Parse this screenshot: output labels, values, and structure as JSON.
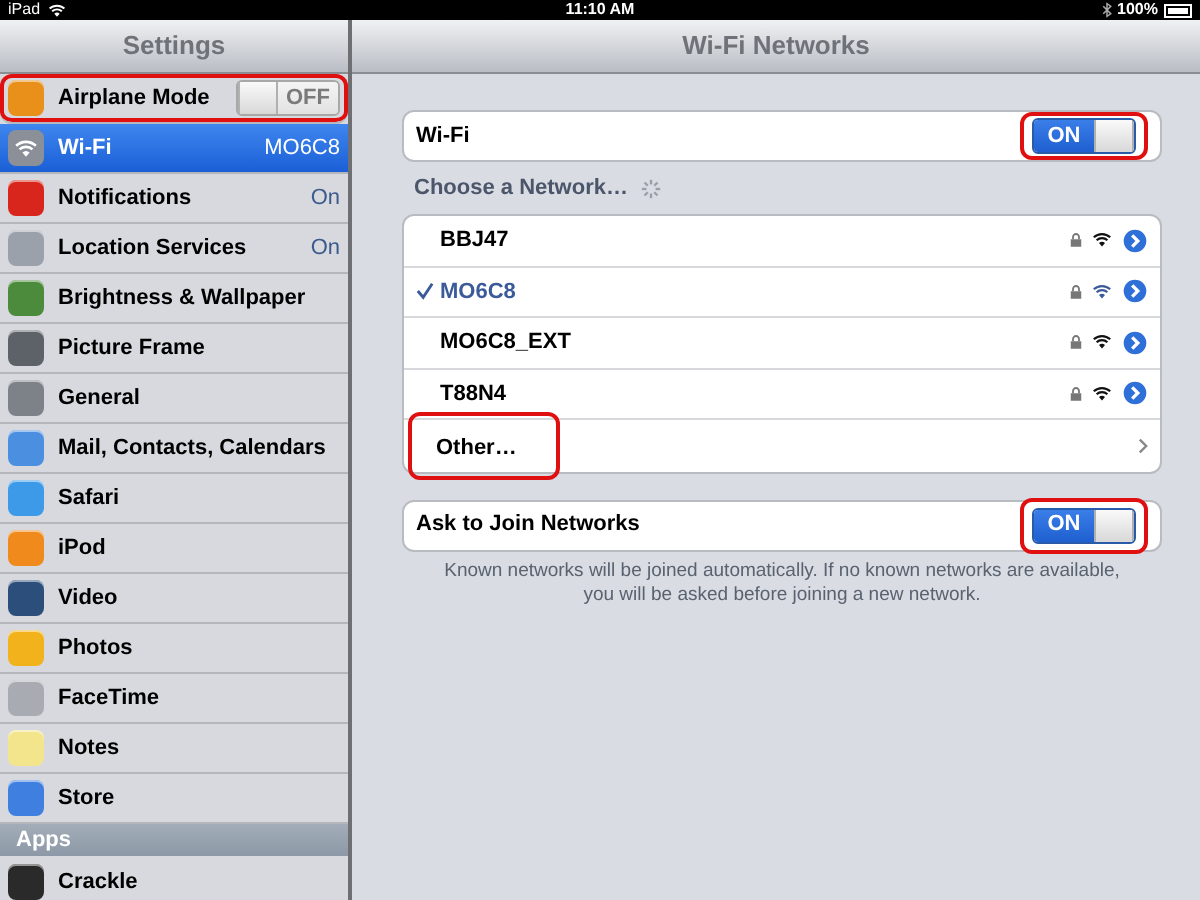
{
  "status_bar": {
    "device": "iPad",
    "time": "11:10 AM",
    "battery": "100%"
  },
  "sidebar": {
    "title": "Settings",
    "items": [
      {
        "label": "Airplane Mode",
        "kind": "toggle",
        "toggle": {
          "on": false,
          "label": "OFF"
        },
        "color": "#e8901a",
        "selected": false,
        "highlighted": true
      },
      {
        "label": "Wi-Fi",
        "kind": "value",
        "value": "MO6C8",
        "color": "#8a8f98",
        "selected": true,
        "highlighted": false
      },
      {
        "label": "Notifications",
        "kind": "value",
        "value": "On",
        "color": "#d9261c",
        "selected": false,
        "highlighted": false
      },
      {
        "label": "Location Services",
        "kind": "value",
        "value": "On",
        "color": "#9aa1ab",
        "selected": false,
        "highlighted": false
      },
      {
        "label": "Brightness & Wallpaper",
        "kind": "plain",
        "color": "#4c8a3c",
        "selected": false,
        "highlighted": false
      },
      {
        "label": "Picture Frame",
        "kind": "plain",
        "color": "#5d6168",
        "selected": false,
        "highlighted": false
      },
      {
        "label": "General",
        "kind": "plain",
        "color": "#7d8188",
        "selected": false,
        "highlighted": false
      },
      {
        "label": "Mail, Contacts, Calendars",
        "kind": "plain",
        "color": "#4a8fe0",
        "selected": false,
        "highlighted": false
      },
      {
        "label": "Safari",
        "kind": "plain",
        "color": "#3c9ae8",
        "selected": false,
        "highlighted": false
      },
      {
        "label": "iPod",
        "kind": "plain",
        "color": "#f08a1c",
        "selected": false,
        "highlighted": false
      },
      {
        "label": "Video",
        "kind": "plain",
        "color": "#2b4f7a",
        "selected": false,
        "highlighted": false
      },
      {
        "label": "Photos",
        "kind": "plain",
        "color": "#f2b21c",
        "selected": false,
        "highlighted": false
      },
      {
        "label": "FaceTime",
        "kind": "plain",
        "color": "#a8acb2",
        "selected": false,
        "highlighted": false
      },
      {
        "label": "Notes",
        "kind": "plain",
        "color": "#f2e58c",
        "selected": false,
        "highlighted": false
      },
      {
        "label": "Store",
        "kind": "plain",
        "color": "#3f7fe0",
        "selected": false,
        "highlighted": false
      }
    ],
    "section": "Apps",
    "more_items": [
      {
        "label": "Crackle",
        "color": "#2a2a2a"
      }
    ]
  },
  "detail": {
    "title": "Wi-Fi Networks",
    "wifi": {
      "label": "Wi-Fi",
      "toggle": {
        "on": true,
        "label": "ON"
      },
      "highlighted": true
    },
    "choose_label": "Choose a Network…",
    "networks": [
      {
        "name": "BBJ47",
        "selected": false,
        "locked": true,
        "highlighted": false
      },
      {
        "name": "MO6C8",
        "selected": true,
        "locked": true,
        "highlighted": false
      },
      {
        "name": "MO6C8_EXT",
        "selected": false,
        "locked": true,
        "highlighted": false
      },
      {
        "name": "T88N4",
        "selected": false,
        "locked": true,
        "highlighted": false
      }
    ],
    "other": {
      "label": "Other…",
      "highlighted": true
    },
    "ask_to_join": {
      "label": "Ask to Join Networks",
      "toggle": {
        "on": true,
        "label": "ON"
      },
      "highlighted": true
    },
    "footnote": "Known networks will be joined automatically.  If no known networks are available, you will be asked before joining a new network."
  }
}
